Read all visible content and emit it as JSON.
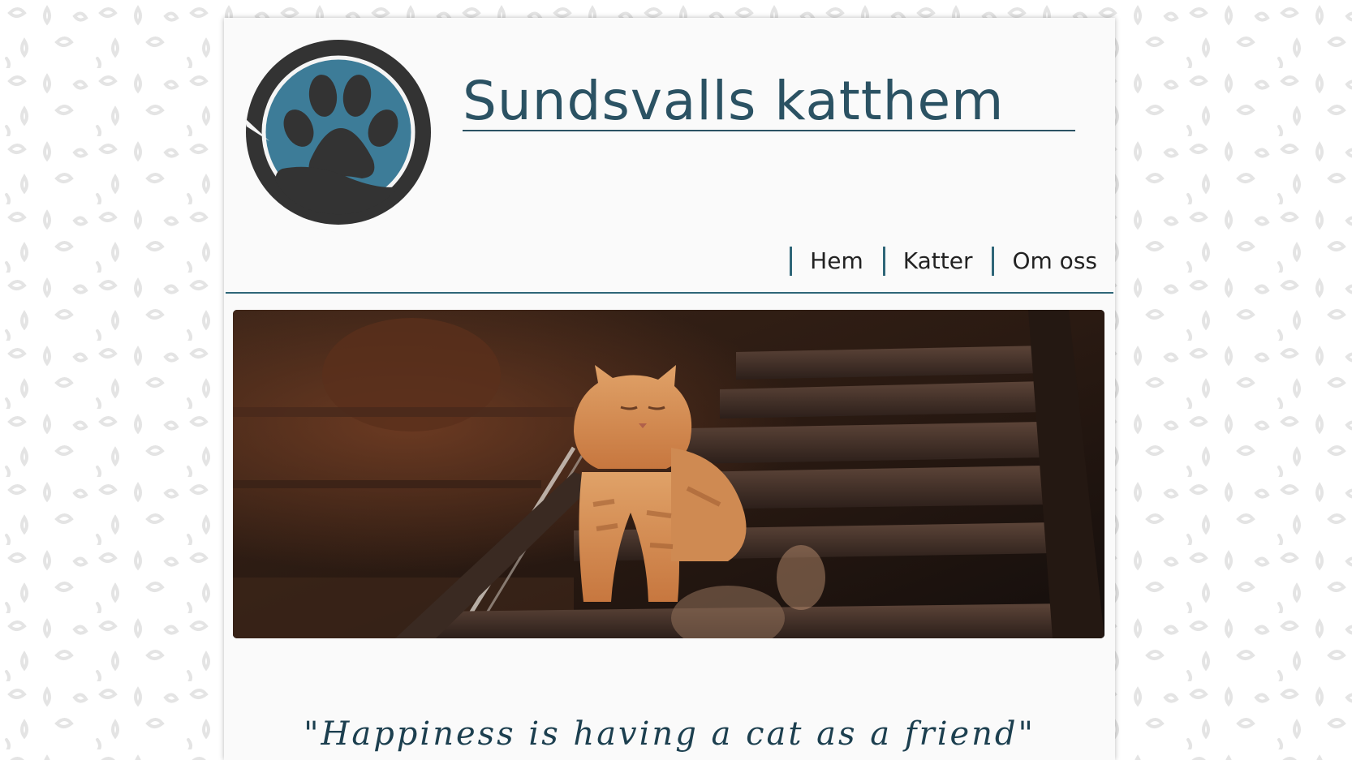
{
  "site": {
    "title": "Sundsvalls katthem",
    "logo_icon": "paw-in-hand-icon"
  },
  "nav": {
    "items": [
      {
        "label": "Hem"
      },
      {
        "label": "Katter"
      },
      {
        "label": "Om oss"
      }
    ]
  },
  "hero": {
    "image": "orange-tabby-cat-on-rusty-stairs"
  },
  "quote": {
    "text": "\"Happiness is having a cat as a friend\""
  },
  "colors": {
    "accent": "#2f6678",
    "title": "#2b5263",
    "logo_blue": "#3d7c98",
    "logo_dark": "#333333",
    "page_bg": "#fafafa"
  }
}
